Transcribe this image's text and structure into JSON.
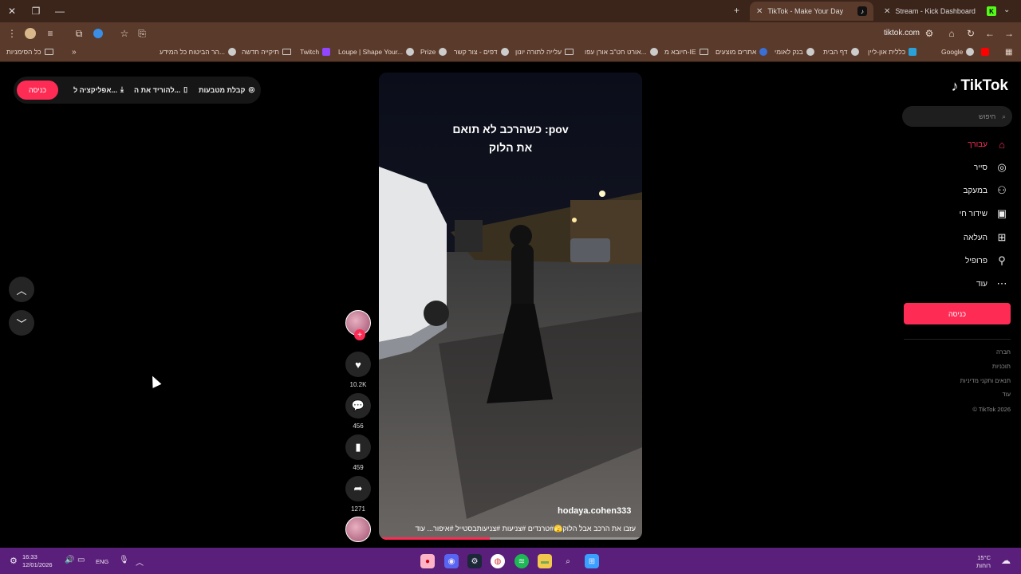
{
  "browser": {
    "tabs": [
      {
        "title": "TikTok - Make Your Day",
        "active": true
      },
      {
        "title": "Stream - Kick Dashboard",
        "active": false
      }
    ],
    "new_tab": "+",
    "address": "tiktok.com",
    "bookmarks_all": "כל הסימניות",
    "bookmarks": [
      "הר הביטוח כל המידע...",
      "תיקייה חדשה",
      "Twitch",
      "Loupe | Shape Your...",
      "Prize",
      "דפים - צור קשר",
      "עלייה לתורה יונון",
      "אורט חט\"ב אורן עפו...",
      "חיובא מ-IE",
      "אתרים מוצעים",
      "בנק לאומי",
      "דף הבית",
      "כללית און-ליין",
      "Google"
    ]
  },
  "header": {
    "login": "כניסה",
    "get_coins": "קבלת מטבעות",
    "download_app": "להוריד את ה...",
    "app": "אפליקציה ל..."
  },
  "video": {
    "caption_line1": "כשהרכב לא תואם :pov",
    "caption_line2": "את הלוק",
    "author": "hodaya.cohen333",
    "description": "עזבו את הרכב אבל הלוק🫣#טרנדים #צניעות #צניעותבסטייל #איפור...",
    "more": "עוד",
    "progress": 0.42
  },
  "actions": {
    "likes": "10.2K",
    "comments": "456",
    "saves": "459",
    "shares": "1271"
  },
  "sidebar": {
    "logo": "TikTok",
    "search_placeholder": "חיפוש",
    "items": [
      {
        "label": "עבורך",
        "icon": "home-icon",
        "active": true
      },
      {
        "label": "סייר",
        "icon": "compass-icon"
      },
      {
        "label": "במעקב",
        "icon": "following-icon"
      },
      {
        "label": "שידור חי",
        "icon": "live-icon"
      },
      {
        "label": "העלאה",
        "icon": "upload-icon"
      },
      {
        "label": "פרופיל",
        "icon": "profile-icon"
      },
      {
        "label": "עוד",
        "icon": "more-icon"
      }
    ],
    "login": "כניסה",
    "footer": [
      "חברה",
      "תוכניות",
      "תנאים ותקני מדיניות",
      "עוד",
      "© TikTok 2026"
    ]
  },
  "taskbar": {
    "time": "16:33",
    "date": "12/01/2026",
    "lang": "ENG",
    "weather_temp": "15°C",
    "weather_desc": "רוחות"
  },
  "colors": {
    "accent": "#fe2c55",
    "chrome": "#5a3a2a",
    "taskbar": "#5a1f7a"
  }
}
